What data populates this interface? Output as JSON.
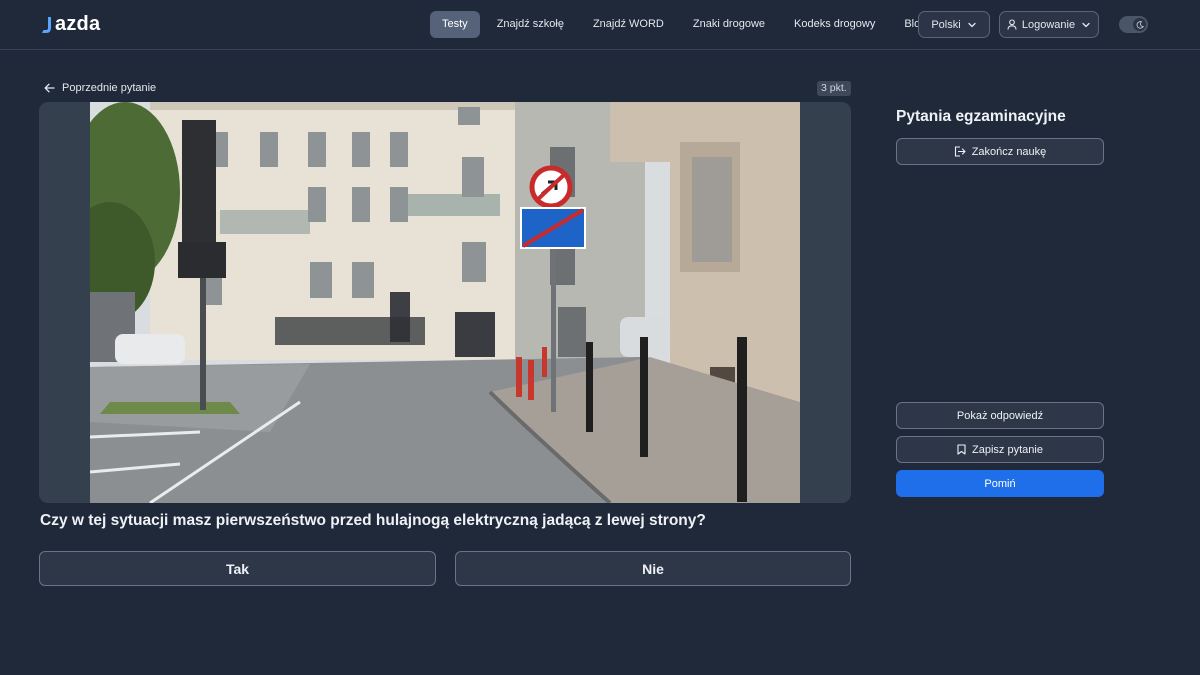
{
  "brand": {
    "logo_text": "azda"
  },
  "nav": {
    "links": [
      {
        "label": "Testy",
        "active": true
      },
      {
        "label": "Znajdź szkołę",
        "active": false
      },
      {
        "label": "Znajdź WORD",
        "active": false
      },
      {
        "label": "Znaki drogowe",
        "active": false
      },
      {
        "label": "Kodeks drogowy",
        "active": false
      },
      {
        "label": "Blog",
        "active": false
      }
    ],
    "language_label": "Polski",
    "login_label": "Logowanie",
    "theme_toggle": {
      "mode": "dark"
    }
  },
  "question": {
    "back_label": "Poprzednie pytanie",
    "points_label": "3 pkt.",
    "text": "Czy w tej sytuacji masz pierwszeństwo przed hulajnogą elektryczną jadącą z lewej strony?",
    "answers": [
      {
        "label": "Tak"
      },
      {
        "label": "Nie"
      }
    ]
  },
  "sidebar": {
    "title": "Pytania egzaminacyjne",
    "end_label": "Zakończ naukę",
    "show_answer_label": "Pokaż odpowiedź",
    "save_label": "Zapisz pytanie",
    "skip_label": "Pomiń"
  },
  "colors": {
    "background": "#202939",
    "accent": "#1f6feb",
    "active_nav": "#55627a"
  }
}
